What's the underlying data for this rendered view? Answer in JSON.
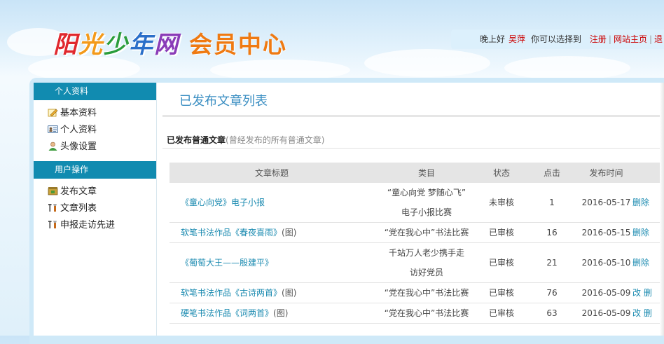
{
  "logo": {
    "part1_chars": [
      "阳",
      "光",
      "少",
      "年",
      "网"
    ],
    "part2": "会员中心"
  },
  "topbar": {
    "greeting": "晚上好",
    "username": "吴萍",
    "choose_text": "你可以选择到",
    "links": [
      "注册",
      "网站主页",
      "退"
    ]
  },
  "sidebar": {
    "section1": {
      "title": "个人资料",
      "items": [
        "基本资料",
        "个人资料",
        "头像设置"
      ],
      "icons": [
        "edit-pencil-icon",
        "id-card-icon",
        "user-avatar-icon"
      ]
    },
    "section2": {
      "title": "用户操作",
      "items": [
        "发布文章",
        "文章列表",
        "申报走访先进"
      ],
      "icons": [
        "publish-box-icon",
        "tools-icon",
        "tools-icon"
      ]
    }
  },
  "main": {
    "page_title": "已发布文章列表",
    "section_title": "已发布普通文章",
    "section_subtitle": "(曾经发布的所有普通文章)",
    "columns": [
      "文章标题",
      "类目",
      "状态",
      "点击",
      "发布时间",
      ""
    ],
    "rows": [
      {
        "title": "《童心向党》电子小报",
        "tag": "",
        "category_line1": "“童心向党 梦随心飞”",
        "category_line2": "电子小报比赛",
        "status": "未审核",
        "clicks": "1",
        "date": "2016-05-17",
        "op": "删除"
      },
      {
        "title": "软笔书法作品《春夜喜雨》",
        "tag": "(图)",
        "category_line1": "“党在我心中”书法比赛",
        "category_line2": "",
        "status": "已审核",
        "clicks": "16",
        "date": "2016-05-15",
        "op": "删除"
      },
      {
        "title": "《葡萄大王——殷建平》",
        "tag": "",
        "category_line1": "千站万人老少携手走",
        "category_line2": "访好党员",
        "status": "已审核",
        "clicks": "21",
        "date": "2016-05-10",
        "op": "删除"
      },
      {
        "title": "软笔书法作品《古诗两首》",
        "tag": "(图)",
        "category_line1": "“党在我心中”书法比赛",
        "category_line2": "",
        "status": "已审核",
        "clicks": "76",
        "date": "2016-05-09",
        "op": "改 删"
      },
      {
        "title": "硬笔书法作品《词两首》",
        "tag": "(图)",
        "category_line1": "“党在我心中”书法比赛",
        "category_line2": "",
        "status": "已审核",
        "clicks": "63",
        "date": "2016-05-09",
        "op": "改 删"
      }
    ]
  },
  "colors": {
    "accent_blue": "#118bb0",
    "title_blue": "#3a8ec2",
    "link_red": "#c00",
    "logo_orange": "#ef7a12"
  }
}
